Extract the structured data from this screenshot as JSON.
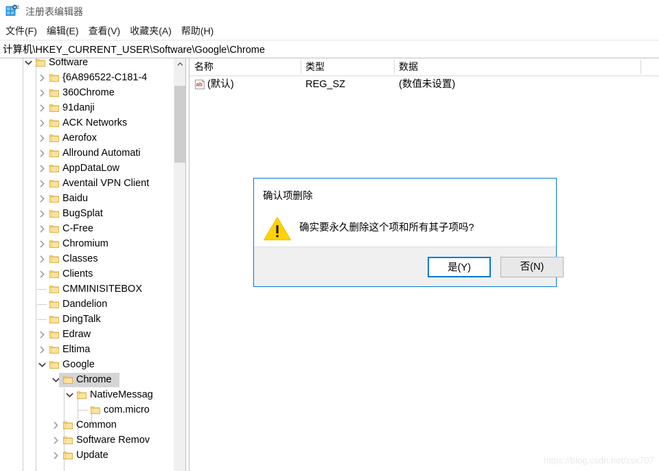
{
  "window": {
    "title": "注册表编辑器",
    "icon": "registry-editor-icon"
  },
  "menu": {
    "items": [
      {
        "label": "文件(F)",
        "name": "menu-file"
      },
      {
        "label": "编辑(E)",
        "name": "menu-edit"
      },
      {
        "label": "查看(V)",
        "name": "menu-view"
      },
      {
        "label": "收藏夹(A)",
        "name": "menu-favorites"
      },
      {
        "label": "帮助(H)",
        "name": "menu-help"
      }
    ]
  },
  "address": {
    "path": "计算机\\HKEY_CURRENT_USER\\Software\\Google\\Chrome"
  },
  "tree": {
    "scrollbar": {
      "up_icon": "chevron-up-icon"
    },
    "items": [
      {
        "label": "Software",
        "depth": 0,
        "arrow": "down",
        "selected": false
      },
      {
        "label": "{6A896522-C181-4",
        "depth": 1,
        "arrow": "right",
        "selected": false
      },
      {
        "label": "360Chrome",
        "depth": 1,
        "arrow": "right",
        "selected": false
      },
      {
        "label": "91danji",
        "depth": 1,
        "arrow": "right",
        "selected": false
      },
      {
        "label": "ACK Networks",
        "depth": 1,
        "arrow": "right",
        "selected": false
      },
      {
        "label": "Aerofox",
        "depth": 1,
        "arrow": "right",
        "selected": false
      },
      {
        "label": "Allround Automati",
        "depth": 1,
        "arrow": "right",
        "selected": false
      },
      {
        "label": "AppDataLow",
        "depth": 1,
        "arrow": "right",
        "selected": false
      },
      {
        "label": "Aventail VPN Client",
        "depth": 1,
        "arrow": "right",
        "selected": false
      },
      {
        "label": "Baidu",
        "depth": 1,
        "arrow": "right",
        "selected": false
      },
      {
        "label": "BugSplat",
        "depth": 1,
        "arrow": "right",
        "selected": false
      },
      {
        "label": "C-Free",
        "depth": 1,
        "arrow": "right",
        "selected": false
      },
      {
        "label": "Chromium",
        "depth": 1,
        "arrow": "right",
        "selected": false
      },
      {
        "label": "Classes",
        "depth": 1,
        "arrow": "right",
        "selected": false
      },
      {
        "label": "Clients",
        "depth": 1,
        "arrow": "right",
        "selected": false
      },
      {
        "label": "CMMINISITEBOX",
        "depth": 1,
        "arrow": "none",
        "selected": false
      },
      {
        "label": "Dandelion",
        "depth": 1,
        "arrow": "none",
        "selected": false
      },
      {
        "label": "DingTalk",
        "depth": 1,
        "arrow": "none",
        "selected": false
      },
      {
        "label": "Edraw",
        "depth": 1,
        "arrow": "right",
        "selected": false
      },
      {
        "label": "Eltima",
        "depth": 1,
        "arrow": "right",
        "selected": false
      },
      {
        "label": "Google",
        "depth": 1,
        "arrow": "down",
        "selected": false
      },
      {
        "label": "Chrome",
        "depth": 2,
        "arrow": "down",
        "selected": true
      },
      {
        "label": "NativeMessag",
        "depth": 3,
        "arrow": "down",
        "selected": false
      },
      {
        "label": "com.micro",
        "depth": 4,
        "arrow": "none",
        "selected": false
      },
      {
        "label": "Common",
        "depth": 2,
        "arrow": "right",
        "selected": false
      },
      {
        "label": "Software Remov",
        "depth": 2,
        "arrow": "right",
        "selected": false
      },
      {
        "label": "Update",
        "depth": 2,
        "arrow": "right",
        "selected": false
      }
    ]
  },
  "list": {
    "columns": [
      {
        "label": "名称",
        "name": "column-name"
      },
      {
        "label": "类型",
        "name": "column-type"
      },
      {
        "label": "数据",
        "name": "column-data"
      }
    ],
    "rows": [
      {
        "icon": "string-value-icon",
        "name": "(默认)",
        "type": "REG_SZ",
        "data": "(数值未设置)"
      }
    ]
  },
  "dialog": {
    "title": "确认项删除",
    "icon": "warning-triangle-icon",
    "message": "确实要永久删除这个项和所有其子项吗?",
    "yes_label": "是(Y)",
    "no_label": "否(N)",
    "accent": "#0078d7"
  },
  "watermark": {
    "text": "https://blog.csdn.net/zsx707"
  }
}
